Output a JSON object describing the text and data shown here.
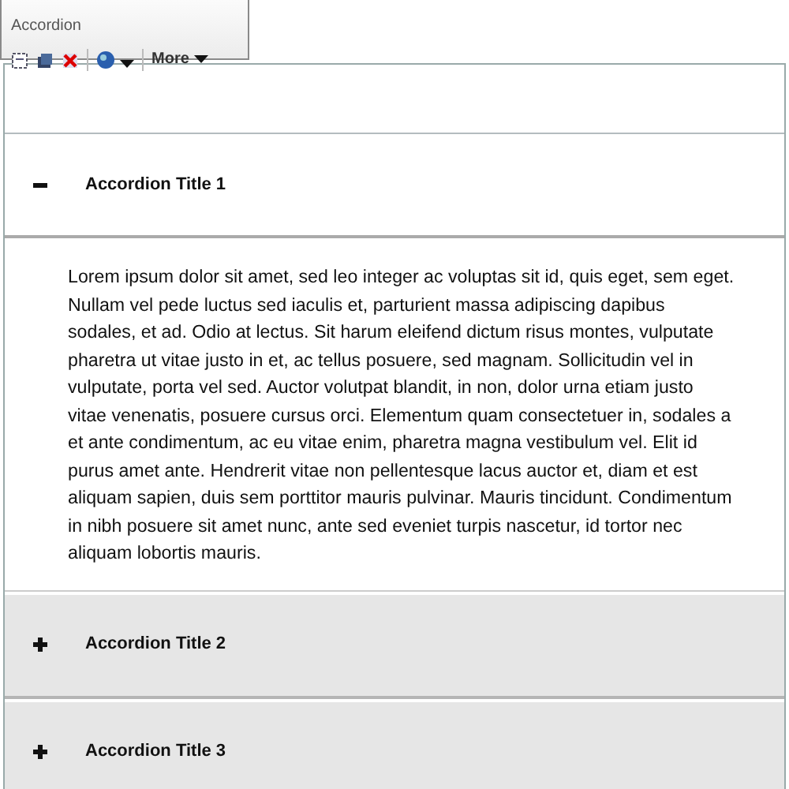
{
  "toolbar": {
    "title": "Accordion",
    "more_label": "More"
  },
  "accordion": [
    {
      "title": "Accordion Title 1",
      "expanded": true,
      "body": "Lorem ipsum dolor sit amet, sed leo integer ac voluptas sit id, quis eget, sem eget. Nullam vel pede luctus sed iaculis et, parturient massa adipiscing dapibus sodales, et ad. Odio at lectus. Sit harum eleifend dictum risus montes, vulputate pharetra ut vitae justo in et, ac tellus posuere, sed magnam. Sollicitudin vel in vulputate, porta vel sed. Auctor volutpat blandit, in non, dolor urna etiam justo vitae venenatis, posuere cursus orci. Elementum quam consectetuer in, sodales a et ante condimentum, ac eu vitae enim, pharetra magna vestibulum vel. Elit id purus amet ante. Hendrerit vitae non pellentesque lacus auctor et, diam et est aliquam sapien, duis sem porttitor mauris pulvinar. Mauris tincidunt. Condimentum in nibh posuere sit amet nunc, ante sed eveniet turpis nascetur, id tortor nec aliquam lobortis mauris."
    },
    {
      "title": "Accordion Title 2",
      "expanded": false
    },
    {
      "title": "Accordion Title 3",
      "expanded": false
    }
  ]
}
